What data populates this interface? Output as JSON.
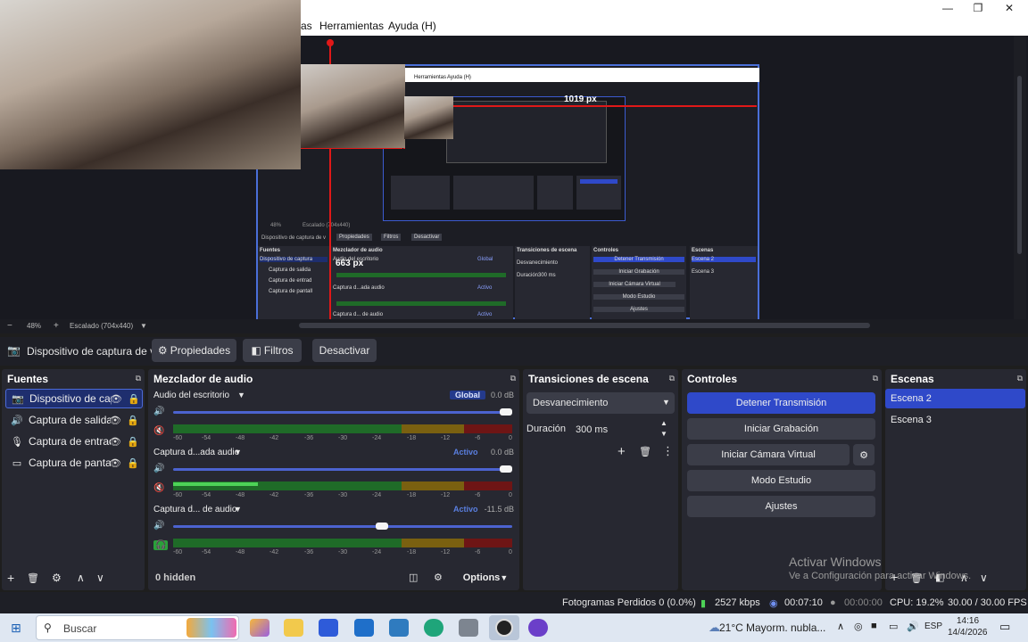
{
  "window": {
    "minimize": "—",
    "maximize": "❐",
    "close": "✕"
  },
  "menu": {
    "items": [
      "as",
      "Herramientas",
      "Ayuda (H)"
    ]
  },
  "preview": {
    "nested_menu": [
      "Herramientas",
      "Ayuda (H)"
    ],
    "measure_1": "1019 px",
    "measure_2": "663 px",
    "nested_sources_title": "Fuentes",
    "nested_mixer_title": "Mezclador de audio",
    "nested_transitions_title": "Transiciones de escena",
    "nested_controls_title": "Controles",
    "nested_scenes_title": "Escenas",
    "nested_sources": [
      "Dispositivo de captura",
      "Captura de salida",
      "Captura de entrad",
      "Captura de pantall"
    ],
    "nested_ctx": [
      "Dispositivo de captura de v",
      "Propiedades",
      "Filtros",
      "Desactivar"
    ],
    "nested_mixer": [
      "Audio del escritorio",
      "Captura d...ada audio",
      "Captura d... de audio"
    ],
    "nested_mixer_badges": [
      "Global",
      "Activo",
      "Activo"
    ],
    "nested_transition": "Desvanecimiento",
    "nested_duration": "Duración",
    "nested_duration_val": "300 ms",
    "nested_controls": [
      "Detener Transmisión",
      "Iniciar Grabación",
      "Iniciar Cámara Virtual",
      "Modo Estudio",
      "Ajustes"
    ],
    "nested_scenes": [
      "Escena 2",
      "Escena 3"
    ],
    "nested_zoom": "48%",
    "nested_scaled": "Escalado (704x440)"
  },
  "zoom": {
    "minus": "−",
    "value": "48%",
    "plus": "+",
    "scaled": "Escalado (704x440)",
    "dropdown": "▼"
  },
  "context": {
    "source_label": "Dispositivo de captura de v",
    "properties": "Propiedades",
    "filters": "Filtros",
    "deactivate": "Desactivar"
  },
  "sources": {
    "title": "Fuentes",
    "items": [
      {
        "label": "Dispositivo de cap",
        "icon": "camera-icon"
      },
      {
        "label": "Captura de salida (",
        "icon": "speaker-icon"
      },
      {
        "label": "Captura de entrad",
        "icon": "microphone-icon"
      },
      {
        "label": "Captura de pantall",
        "icon": "monitor-icon"
      }
    ],
    "footer": {
      "add": "+",
      "remove": "🗑",
      "settings": "⚙",
      "up": "∧",
      "down": "∨"
    }
  },
  "mixer": {
    "title": "Mezclador de audio",
    "channels": [
      {
        "name": "Audio del escritorio",
        "badge": "Global",
        "db": "0.0 dB",
        "volume": 1.0,
        "level": 0.0
      },
      {
        "name": "Captura d...ada audio",
        "badge": "Activo",
        "db": "0.0 dB",
        "volume": 1.0,
        "level": 0.25
      },
      {
        "name": "Captura d... de audio",
        "badge": "Activo",
        "db": "-11.5 dB",
        "volume": 0.62,
        "level": 0.0
      }
    ],
    "scale": [
      "-60",
      "-54",
      "-48",
      "-42",
      "-36",
      "-30",
      "-24",
      "-18",
      "-12",
      "-6",
      "0"
    ],
    "footer": {
      "hidden": "0 hidden",
      "options": "Options"
    }
  },
  "transitions": {
    "title": "Transiciones de escena",
    "type": "Desvanecimiento",
    "duration_label": "Duración",
    "duration_value": "300 ms"
  },
  "controls": {
    "title": "Controles",
    "stop_stream": "Detener Transmisión",
    "start_recording": "Iniciar Grabación",
    "virtual_cam": "Iniciar Cámara Virtual",
    "studio_mode": "Modo Estudio",
    "settings": "Ajustes"
  },
  "scenes": {
    "title": "Escenas",
    "items": [
      "Escena 2",
      "Escena 3"
    ],
    "selected": 0
  },
  "watermark": {
    "line1": "Activar Windows",
    "line2": "Ve a Configuración para activar Windows."
  },
  "status": {
    "dropped": "Fotogramas Perdidos 0 (0.0%)",
    "bitrate": "2527 kbps",
    "stream_time": "00:07:10",
    "rec_time": "00:00:00",
    "cpu": "CPU: 19.2%",
    "fps": "30.00 / 30.00 FPS"
  },
  "taskbar": {
    "search_placeholder": "Buscar",
    "weather_temp": "21°C",
    "weather_desc": "Mayorm. nubla...",
    "lang": "ESP",
    "time": "14:16",
    "date": "14/4/2026",
    "chevron": "∧"
  },
  "colors": {
    "accent": "#2f49c9",
    "selected": "#1e2e6e",
    "panel": "#272831",
    "bg": "#1e1e1e"
  }
}
